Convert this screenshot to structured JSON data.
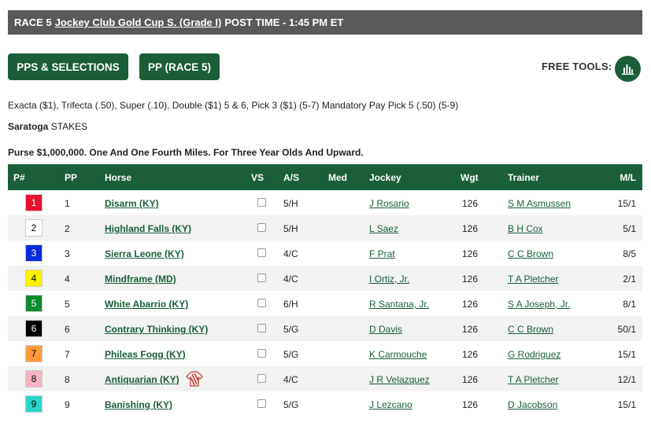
{
  "header": {
    "race_label": "RACE 5",
    "race_name": "Jockey Club Gold Cup S. (Grade I)",
    "post_time": "POST TIME - 1:45 PM ET"
  },
  "buttons": {
    "pps_selections": "PPS & SELECTIONS",
    "pp_race": "PP (RACE 5)"
  },
  "tools": {
    "label": "FREE TOOLS:",
    "icon": "bar-chart-icon"
  },
  "info": {
    "wagers": "Exacta ($1), Trifecta (.50), Super (.10), Double ($1) 5 & 6, Pick 3 ($1) (5-7) Mandatory Pay Pick 5 (.50) (5-9)",
    "track": "Saratoga",
    "race_type": "STAKES",
    "purse": "Purse $1,000,000. One And One Fourth Miles. For Three Year Olds And Upward."
  },
  "colors": {
    "brand_green": "#1a5e3a",
    "header_gray": "#5a5a5a"
  },
  "table": {
    "headers": {
      "pnum": "P#",
      "pp": "PP",
      "horse": "Horse",
      "vs": "VS",
      "as": "A/S",
      "med": "Med",
      "jockey": "Jockey",
      "wgt": "Wgt",
      "trainer": "Trainer",
      "ml": "M/L"
    },
    "rows": [
      {
        "pnum": "1",
        "pp": "1",
        "horse": "Disarm (KY)",
        "as": "5/H",
        "med": "",
        "jockey": "J Rosario",
        "wgt": "126",
        "trainer": "S M Asmussen",
        "ml": "15/1",
        "bg": "#e8112d",
        "fg": "#ffffff"
      },
      {
        "pnum": "2",
        "pp": "2",
        "horse": "Highland Falls (KY)",
        "as": "5/H",
        "med": "",
        "jockey": "L Saez",
        "wgt": "126",
        "trainer": "B H Cox",
        "ml": "5/1",
        "bg": "#ffffff",
        "fg": "#000000"
      },
      {
        "pnum": "3",
        "pp": "3",
        "horse": "Sierra Leone (KY)",
        "as": "4/C",
        "med": "",
        "jockey": "F Prat",
        "wgt": "126",
        "trainer": "C C Brown",
        "ml": "8/5",
        "bg": "#0b2bd6",
        "fg": "#ffffff"
      },
      {
        "pnum": "4",
        "pp": "4",
        "horse": "Mindframe (MD)",
        "as": "4/C",
        "med": "",
        "jockey": "I Ortiz, Jr.",
        "wgt": "126",
        "trainer": "T A Pletcher",
        "ml": "2/1",
        "bg": "#fff200",
        "fg": "#000000"
      },
      {
        "pnum": "5",
        "pp": "5",
        "horse": "White Abarrio (KY)",
        "as": "6/H",
        "med": "",
        "jockey": "R Santana, Jr.",
        "wgt": "126",
        "trainer": "S A Joseph, Jr.",
        "ml": "8/1",
        "bg": "#0c8a2e",
        "fg": "#ffffff"
      },
      {
        "pnum": "6",
        "pp": "6",
        "horse": "Contrary Thinking (KY)",
        "as": "5/G",
        "med": "",
        "jockey": "D Davis",
        "wgt": "126",
        "trainer": "C C Brown",
        "ml": "50/1",
        "bg": "#000000",
        "fg": "#ffffff"
      },
      {
        "pnum": "7",
        "pp": "7",
        "horse": "Phileas Fogg (KY)",
        "as": "5/G",
        "med": "",
        "jockey": "K Carmouche",
        "wgt": "126",
        "trainer": "G Rodriguez",
        "ml": "15/1",
        "bg": "#ff9a3c",
        "fg": "#000000"
      },
      {
        "pnum": "8",
        "pp": "8",
        "horse": "Antiquarian (KY)",
        "as": "4/C",
        "med": "",
        "jockey": "J R Velazquez",
        "wgt": "126",
        "trainer": "T A Pletcher",
        "ml": "12/1",
        "bg": "#f9b4c4",
        "fg": "#000000",
        "silk": true
      },
      {
        "pnum": "9",
        "pp": "9",
        "horse": "Banishing (KY)",
        "as": "5/G",
        "med": "",
        "jockey": "J Lezcano",
        "wgt": "126",
        "trainer": "D Jacobson",
        "ml": "15/1",
        "bg": "#29d6c8",
        "fg": "#000000"
      }
    ]
  }
}
